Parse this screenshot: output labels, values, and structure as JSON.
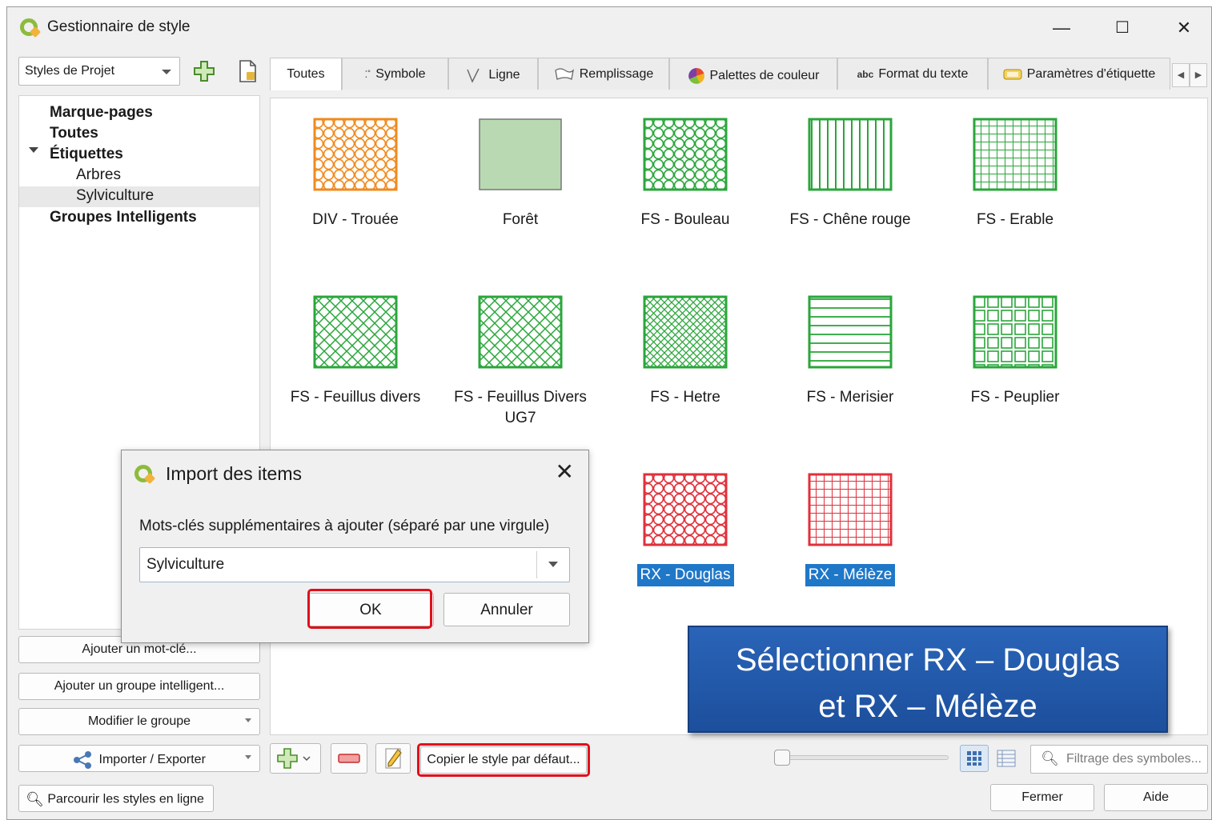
{
  "window": {
    "title": "Gestionnaire de style",
    "controls": {
      "minimize": "—",
      "maximize": "☐",
      "close": "✕"
    }
  },
  "toolbar": {
    "style_source": "Styles de Projet"
  },
  "tabs": [
    {
      "label": "Toutes",
      "active": true
    },
    {
      "label": "Symbole",
      "icon": "symbol-icon"
    },
    {
      "label": "Ligne",
      "icon": "line-icon"
    },
    {
      "label": "Remplissage",
      "icon": "fill-icon"
    },
    {
      "label": "Palettes de couleur",
      "icon": "color-ramp-icon"
    },
    {
      "label": "Format du texte",
      "icon": "text-format-icon",
      "icon_text": "abc"
    },
    {
      "label": "Paramètres d'étiquette",
      "icon": "label-settings-icon"
    }
  ],
  "tree": {
    "items": [
      {
        "label": "Marque-pages",
        "bold": true
      },
      {
        "label": "Toutes",
        "bold": true
      },
      {
        "label": "Étiquettes",
        "bold": true,
        "expanded": true
      },
      {
        "label": "Arbres"
      },
      {
        "label": "Sylviculture",
        "selected": true
      },
      {
        "label": "Groupes Intelligents",
        "bold": true
      }
    ]
  },
  "symbols": [
    {
      "label": "DIV - Trouée",
      "color": "#f08a1e",
      "pattern": "circles"
    },
    {
      "label": "Forêt",
      "color": "#8fbf8a",
      "pattern": "solid"
    },
    {
      "label": "FS - Bouleau",
      "color": "#2aa63b",
      "pattern": "circles"
    },
    {
      "label": "FS - Chêne rouge",
      "color": "#2aa63b",
      "pattern": "vertical"
    },
    {
      "label": "FS - Erable",
      "color": "#2aa63b",
      "pattern": "grid"
    },
    {
      "label": "FS - Feuillus divers",
      "color": "#2aa63b",
      "pattern": "cross"
    },
    {
      "label": "FS - Feuillus Divers UG7",
      "color": "#2aa63b",
      "pattern": "cross"
    },
    {
      "label": "FS - Hetre",
      "color": "#2aa63b",
      "pattern": "densecross"
    },
    {
      "label": "FS - Merisier",
      "color": "#2aa63b",
      "pattern": "horizontal"
    },
    {
      "label": "FS - Peuplier",
      "color": "#2aa63b",
      "pattern": "bricks"
    },
    {
      "label": "RX - Douglas",
      "color": "#e0303a",
      "pattern": "circles",
      "selected": true
    },
    {
      "label": "RX - Mélèze",
      "color": "#e0303a",
      "pattern": "grid",
      "selected": true
    }
  ],
  "left_buttons": {
    "add_tag": "Ajouter un mot-clé...",
    "add_smart_group": "Ajouter un groupe intelligent...",
    "modify_group": "Modifier le groupe",
    "import_export": "Importer / Exporter",
    "browse_online": "Parcourir les styles en ligne"
  },
  "bottom": {
    "copy_default": "Copier le style par défaut...",
    "filter_placeholder": "Filtrage des symboles...",
    "close": "Fermer",
    "help": "Aide"
  },
  "dialog": {
    "title": "Import des items",
    "label": "Mots-clés supplémentaires à ajouter (séparé par une virgule)",
    "value": "Sylviculture",
    "ok": "OK",
    "cancel": "Annuler"
  },
  "callout": {
    "line1": "Sélectionner RX – Douglas",
    "line2": "et RX – Mélèze"
  }
}
